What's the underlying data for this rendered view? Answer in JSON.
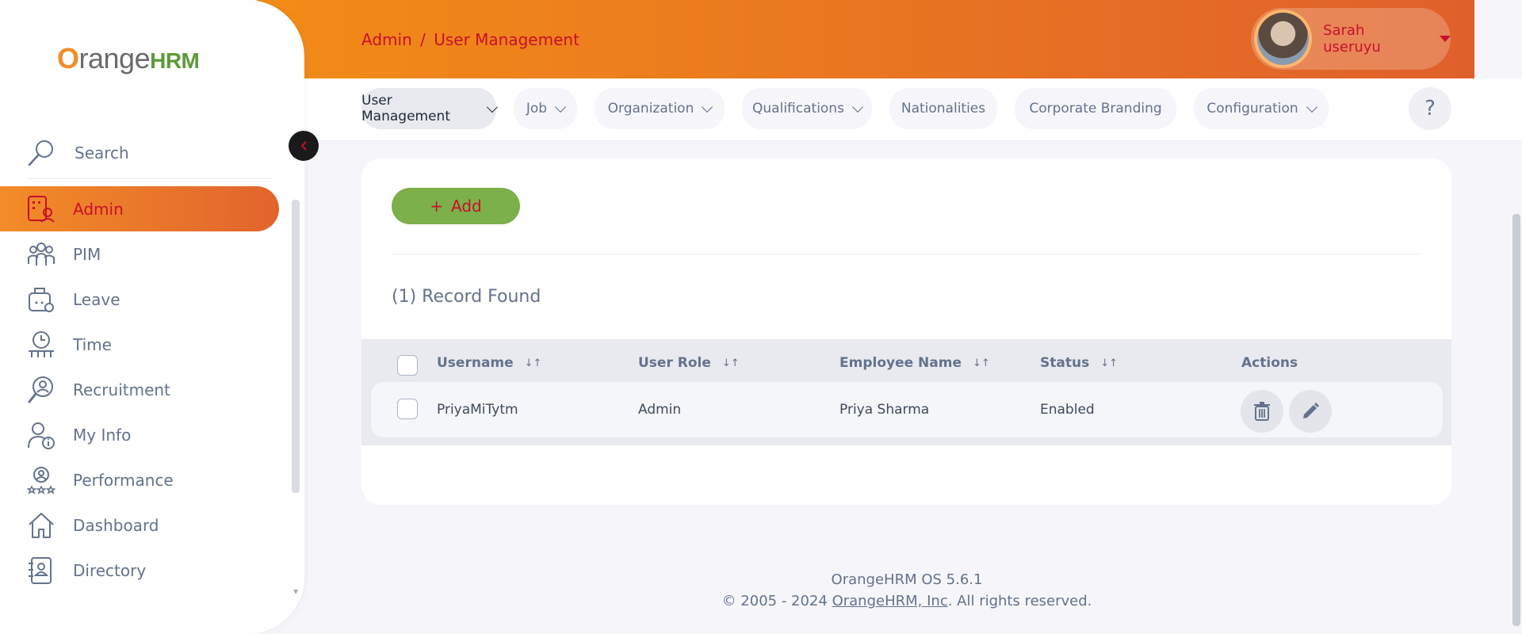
{
  "brand": {
    "logo_text": "OrangeHRM"
  },
  "sidebar": {
    "search_placeholder": "Search",
    "items": [
      {
        "label": "Admin",
        "icon": "admin-icon",
        "active": true
      },
      {
        "label": "PIM",
        "icon": "pim-icon"
      },
      {
        "label": "Leave",
        "icon": "leave-icon"
      },
      {
        "label": "Time",
        "icon": "time-icon"
      },
      {
        "label": "Recruitment",
        "icon": "recruitment-icon"
      },
      {
        "label": "My Info",
        "icon": "my-info-icon"
      },
      {
        "label": "Performance",
        "icon": "performance-icon"
      },
      {
        "label": "Dashboard",
        "icon": "dashboard-icon"
      },
      {
        "label": "Directory",
        "icon": "directory-icon"
      }
    ]
  },
  "header": {
    "breadcrumb_module": "Admin",
    "breadcrumb_separator": "/",
    "breadcrumb_page": "User Management",
    "user_name": "Sarah useruyu"
  },
  "topmenu": {
    "items": [
      {
        "label": "User Management",
        "dropdown": true,
        "active": true
      },
      {
        "label": "Job",
        "dropdown": true
      },
      {
        "label": "Organization",
        "dropdown": true
      },
      {
        "label": "Qualifications",
        "dropdown": true
      },
      {
        "label": "Nationalities",
        "dropdown": false
      },
      {
        "label": "Corporate Branding",
        "dropdown": false
      },
      {
        "label": "Configuration",
        "dropdown": true
      }
    ],
    "help_label": "?"
  },
  "main": {
    "add_label": "Add",
    "add_icon": "plus-icon",
    "records_found": "(1) Record Found",
    "table": {
      "columns": [
        "Username",
        "User Role",
        "Employee Name",
        "Status",
        "Actions"
      ],
      "rows": [
        {
          "username": "PriyaMiTytm",
          "user_role": "Admin",
          "employee_name": "Priya Sharma",
          "status": "Enabled"
        }
      ]
    }
  },
  "footer": {
    "version": "OrangeHRM OS 5.6.1",
    "copyright_prefix": "© 2005 - 2024 ",
    "company_link": "OrangeHRM, Inc",
    "copyright_suffix": ". All rights reserved."
  },
  "colors": {
    "accent_orange": "#f28c17",
    "accent_red": "#c8102e",
    "add_button_green": "#7bb04a",
    "text_muted": "#64728c"
  }
}
